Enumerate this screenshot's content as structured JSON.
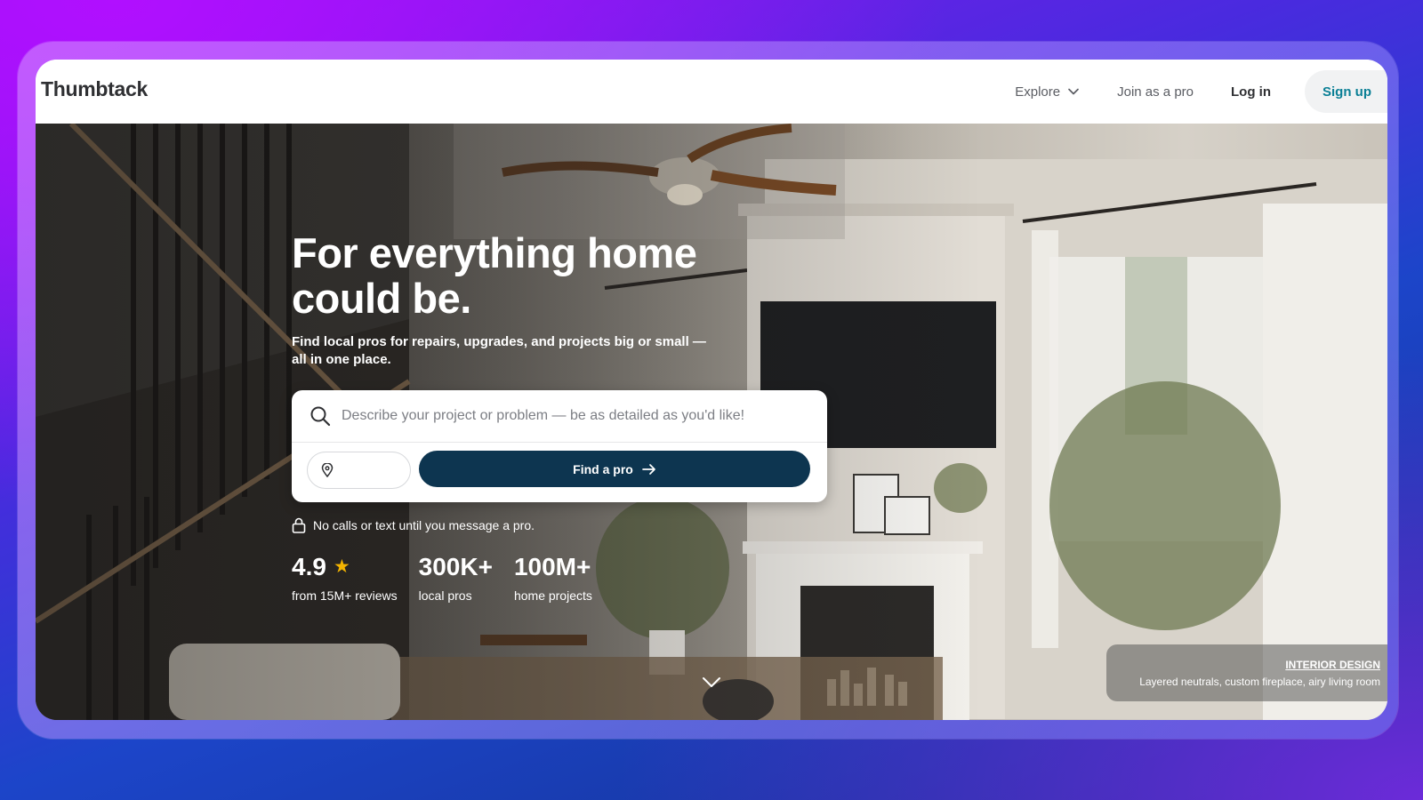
{
  "brand": {
    "name": "Thumbtack"
  },
  "nav": {
    "explore_label": "Explore",
    "join_label": "Join as a pro",
    "login_label": "Log in",
    "signup_label": "Sign up"
  },
  "hero": {
    "headline": "For everything home could be.",
    "subhead": "Find local pros for repairs, upgrades, and projects big or small — all in one place.",
    "search": {
      "placeholder": "Describe your project or problem — be as detailed as you'd like!",
      "value": "",
      "zip_value": ""
    },
    "cta_label": "Find a pro",
    "privacy_note": "No calls or text until you message a pro.",
    "stats": [
      {
        "value": "4.9",
        "label": "from 15M+ reviews",
        "icon": "star-icon"
      },
      {
        "value": "300K+",
        "label": "local pros"
      },
      {
        "value": "100M+",
        "label": "home projects"
      }
    ],
    "caption": {
      "title": "INTERIOR DESIGN",
      "description": "Layered neutrals, custom fireplace, airy living room"
    }
  },
  "colors": {
    "primary_button": "#0d3550",
    "signup_text": "#0a7f95",
    "star": "#f4b400"
  }
}
